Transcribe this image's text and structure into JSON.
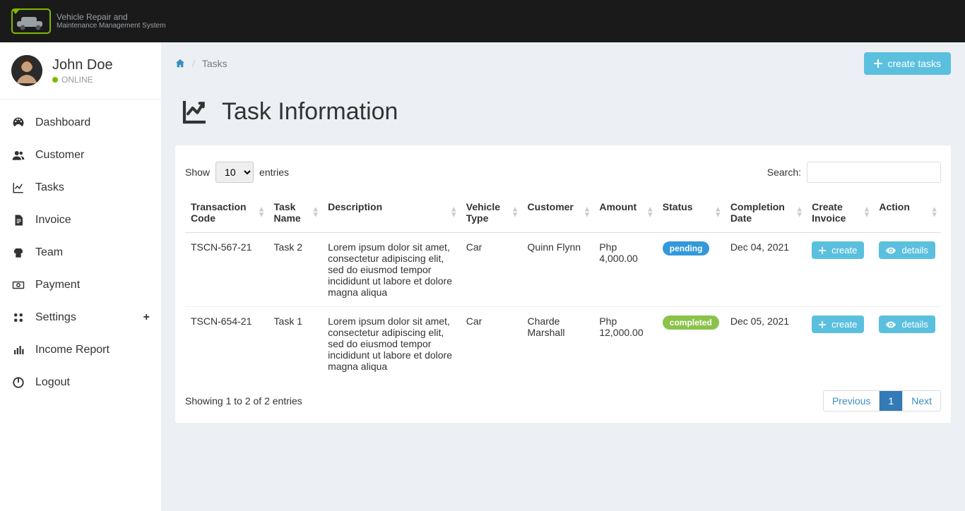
{
  "header": {
    "brand_line1": "Vehicle Repair and",
    "brand_line2": "Maintenance Management System"
  },
  "user": {
    "name": "John Doe",
    "status": "ONLINE"
  },
  "sidebar": {
    "items": [
      {
        "label": "Dashboard"
      },
      {
        "label": "Customer"
      },
      {
        "label": "Tasks"
      },
      {
        "label": "Invoice"
      },
      {
        "label": "Team"
      },
      {
        "label": "Payment"
      },
      {
        "label": "Settings"
      },
      {
        "label": "Income Report"
      },
      {
        "label": "Logout"
      }
    ]
  },
  "breadcrumb": {
    "current": "Tasks"
  },
  "actions": {
    "create_tasks": "create tasks"
  },
  "page": {
    "title": "Task Information"
  },
  "table": {
    "show_label": "Show",
    "entries_label": "entries",
    "entries_value": "10",
    "search_label": "Search:",
    "search_value": "",
    "columns": [
      "Transaction Code",
      "Task Name",
      "Description",
      "Vehicle Type",
      "Customer",
      "Amount",
      "Status",
      "Completion Date",
      "Create Invoice",
      "Action"
    ],
    "rows": [
      {
        "code": "TSCN-567-21",
        "name": "Task 2",
        "description": "Lorem ipsum dolor sit amet, consectetur adipiscing elit, sed do eiusmod tempor incididunt ut labore et dolore magna aliqua",
        "vehicle": "Car",
        "customer": "Quinn Flynn",
        "amount": "Php 4,000.00",
        "status": "pending",
        "status_class": "pending",
        "date": "Dec 04, 2021",
        "invoice_btn": "create",
        "action_btn": "details"
      },
      {
        "code": "TSCN-654-21",
        "name": "Task 1",
        "description": "Lorem ipsum dolor sit amet, consectetur adipiscing elit, sed do eiusmod tempor incididunt ut labore et dolore magna aliqua",
        "vehicle": "Car",
        "customer": "Charde Marshall",
        "amount": "Php 12,000.00",
        "status": "completed",
        "status_class": "completed",
        "date": "Dec 05, 2021",
        "invoice_btn": "create",
        "action_btn": "details"
      }
    ],
    "info": "Showing 1 to 2 of 2 entries",
    "pagination": {
      "prev": "Previous",
      "pages": [
        "1"
      ],
      "next": "Next",
      "active": "1"
    }
  }
}
